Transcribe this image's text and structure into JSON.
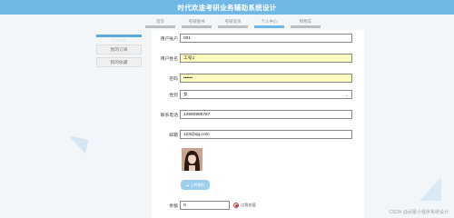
{
  "app": {
    "title": "时代欢途考研业务辅助系统设计"
  },
  "nav": {
    "items": [
      "首页",
      "考研图书",
      "考研资讯",
      "个人中心",
      "购物车"
    ]
  },
  "sidebar": {
    "faint_label": "个人中心",
    "items": [
      "我的订单",
      "我的收藏"
    ]
  },
  "form": {
    "account_label": "用户账户",
    "account_value": "001",
    "name_label": "用户姓名",
    "name_value": "工号1",
    "password_label": "密码",
    "password_value": "••••••",
    "gender_label": "性别",
    "gender_value": "女",
    "phone_label": "联系电话",
    "phone_value": "13560998787",
    "email_label": "邮箱",
    "email_value": "123@qq.com",
    "upload_label": "上传图片",
    "balance_label": "余额",
    "balance_value": "0",
    "recharge_label": "点我充值"
  },
  "colors": {
    "header": "#6fb8e6",
    "accent": "#5aa9d8",
    "highlight": "#fdfbbd"
  },
  "watermark": "CSDN @武蒙小程序系统设计"
}
